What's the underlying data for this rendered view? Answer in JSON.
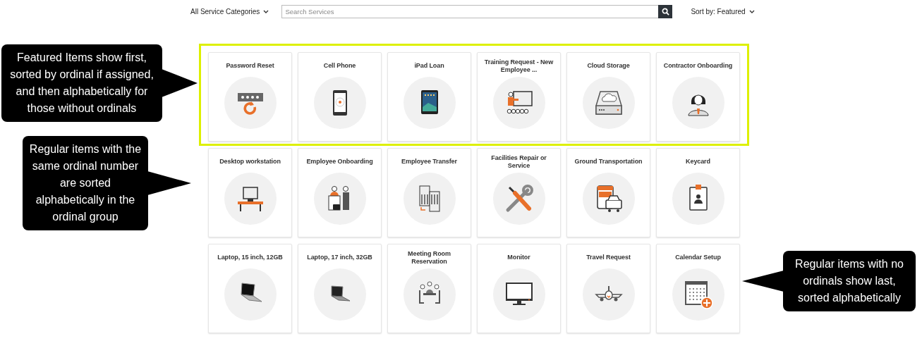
{
  "toolbar": {
    "category_filter": "All Service Categories",
    "search": {
      "placeholder": "Search Services"
    },
    "sort": "Sort by: Featured"
  },
  "rows": [
    {
      "featured": true,
      "items": [
        {
          "title": "Password Reset"
        },
        {
          "title": "Cell Phone"
        },
        {
          "title": "iPad Loan"
        },
        {
          "title": "Training Request - New Employee ..."
        },
        {
          "title": "Cloud Storage"
        },
        {
          "title": "Contractor Onboarding"
        }
      ]
    },
    {
      "featured": false,
      "items": [
        {
          "title": "Desktop workstation"
        },
        {
          "title": "Employee Onboarding"
        },
        {
          "title": "Employee Transfer"
        },
        {
          "title": "Facilities Repair or Service"
        },
        {
          "title": "Ground Transportation"
        },
        {
          "title": "Keycard"
        }
      ]
    },
    {
      "featured": false,
      "items": [
        {
          "title": "Laptop, 15 inch, 12GB"
        },
        {
          "title": "Laptop, 17 inch, 32GB"
        },
        {
          "title": "Meeting Room Reservation"
        },
        {
          "title": "Monitor"
        },
        {
          "title": "Travel Request"
        },
        {
          "title": "Calendar Setup"
        }
      ]
    }
  ],
  "callouts": [
    {
      "text": "Featured Items show first, sorted by ordinal if assigned, and then alphabetically for those without ordinals",
      "kind": "right"
    },
    {
      "text": "Regular items with the same ordinal number are sorted alphabetically in the ordinal group",
      "kind": "right"
    },
    {
      "text": "Regular items with no ordinals show last, sorted alphabetically",
      "kind": "left"
    }
  ]
}
